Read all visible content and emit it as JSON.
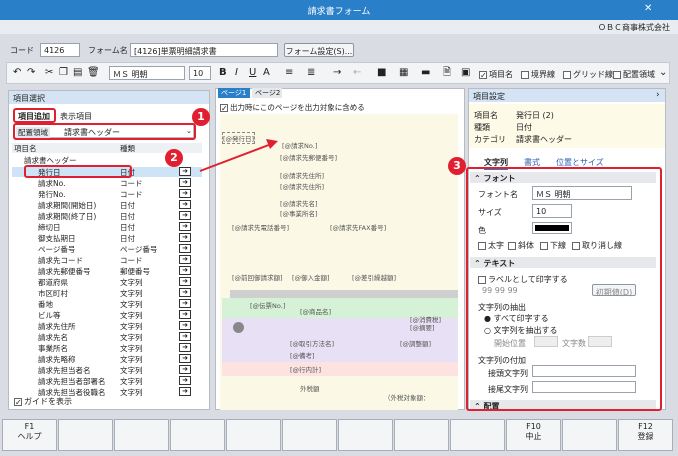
{
  "window": {
    "title": "請求書フォーム",
    "company": "ＯＢＣ商事株式会社"
  },
  "codebar": {
    "code_label": "コード",
    "code_value": "4126",
    "form_label": "フォーム名",
    "form_value": "[4126]単票明細請求書",
    "settings_button": "フォーム設定(S)..."
  },
  "toolbar": {
    "font_name": "ＭＳ 明朝",
    "font_size": "10",
    "bold": "B",
    "italic": "I",
    "underline": "U",
    "checks": [
      {
        "label": "項目名",
        "checked": true
      },
      {
        "label": "境界線",
        "checked": false
      },
      {
        "label": "グリッド線",
        "checked": false
      },
      {
        "label": "配置領域",
        "checked": false
      }
    ]
  },
  "left_panel": {
    "header": "項目選択",
    "tabs": [
      "項目追加",
      "表示項目"
    ],
    "area_label": "配置領域",
    "area_value": "請求書ヘッダー",
    "columns": [
      "項目名",
      "種類"
    ],
    "group": "請求書ヘッダー",
    "items": [
      {
        "name": "発行日",
        "type": "日付"
      },
      {
        "name": "請求No.",
        "type": "コード"
      },
      {
        "name": "発行No.",
        "type": "コード"
      },
      {
        "name": "請求期間(開始日)",
        "type": "日付"
      },
      {
        "name": "請求期間(終了日)",
        "type": "日付"
      },
      {
        "name": "締切日",
        "type": "日付"
      },
      {
        "name": "御支払期日",
        "type": "日付"
      },
      {
        "name": "ページ番号",
        "type": "ページ番号"
      },
      {
        "name": "請求先コード",
        "type": "コード"
      },
      {
        "name": "請求先郵便番号",
        "type": "郵便番号"
      },
      {
        "name": "都道府県",
        "type": "文字列"
      },
      {
        "name": "市区町村",
        "type": "文字列"
      },
      {
        "name": "番地",
        "type": "文字列"
      },
      {
        "name": "ビル等",
        "type": "文字列"
      },
      {
        "name": "請求先住所",
        "type": "文字列"
      },
      {
        "name": "請求先名",
        "type": "文字列"
      },
      {
        "name": "事業所名",
        "type": "文字列"
      },
      {
        "name": "請求先略称",
        "type": "文字列"
      },
      {
        "name": "請求先担当者名",
        "type": "文字列"
      },
      {
        "name": "請求先担当者部署名",
        "type": "文字列"
      },
      {
        "name": "請求先担当者役職名",
        "type": "文字列"
      }
    ],
    "guide_label": "ガイドを表示"
  },
  "center": {
    "tabs": [
      "ページ1",
      "ページ2"
    ],
    "include_label": "出力時にこのページを出力対象に含める",
    "fields": [
      "[@発行日]",
      "[@請求No.]",
      "[@請求先郵便番号]",
      "[@請求先住所]",
      "[@請求先住所]",
      "[@請求先名]",
      "[@事業所名]",
      "[@請求先電話番号]",
      "[@請求先FAX番号]",
      "[@前回御請求額]",
      "[@御入金額]",
      "[@差引繰越額]",
      "[@伝票No.]",
      "[@商品名]",
      "[@消費税]",
      "[@摘要]",
      "[@取引方法名]",
      "[@調整額]",
      "[@備考]",
      "[@行内計]",
      "外税額",
      "（外税対象額："
    ]
  },
  "right_panel": {
    "header": "項目設定",
    "info": [
      {
        "k": "項目名",
        "v": "発行日 (2)"
      },
      {
        "k": "種類",
        "v": "日付"
      },
      {
        "k": "カテゴリ",
        "v": "請求書ヘッダー"
      }
    ],
    "tabs": [
      "文字列",
      "書式",
      "位置とサイズ"
    ],
    "font_section": "フォント",
    "font_name_label": "フォント名",
    "font_name_value": "ＭＳ 明朝",
    "size_label": "サイズ",
    "size_value": "10",
    "color_label": "色",
    "styles": [
      "太字",
      "斜体",
      "下線",
      "取り消し線"
    ],
    "text_section": "テキスト",
    "label_print": "ラベルとして印字する",
    "label_sample": "99  99  99",
    "init_button": "初期値(D)",
    "extract_label": "文字列の抽出",
    "extract_all": "すべて印字する",
    "extract_part": "文字列を抽出する",
    "start_label": "開始位置",
    "count_label": "文字数",
    "affix_label": "文字列の付加",
    "prefix_label": "接頭文字列",
    "suffix_label": "接尾文字列",
    "layout_section": "配置"
  },
  "fkeys": [
    {
      "key": "F1",
      "label": "ヘルプ"
    },
    {
      "key": "",
      "label": ""
    },
    {
      "key": "",
      "label": ""
    },
    {
      "key": "",
      "label": ""
    },
    {
      "key": "",
      "label": ""
    },
    {
      "key": "",
      "label": ""
    },
    {
      "key": "",
      "label": ""
    },
    {
      "key": "",
      "label": ""
    },
    {
      "key": "",
      "label": ""
    },
    {
      "key": "F10",
      "label": "中止"
    },
    {
      "key": "",
      "label": ""
    },
    {
      "key": "F12",
      "label": "登録"
    }
  ],
  "callouts": [
    "1",
    "2",
    "3"
  ],
  "colors": {
    "title": "#2a7fc9",
    "callout": "#e02030",
    "selection": "#cfe3f7",
    "layout_bg": "#fbf9e6"
  }
}
